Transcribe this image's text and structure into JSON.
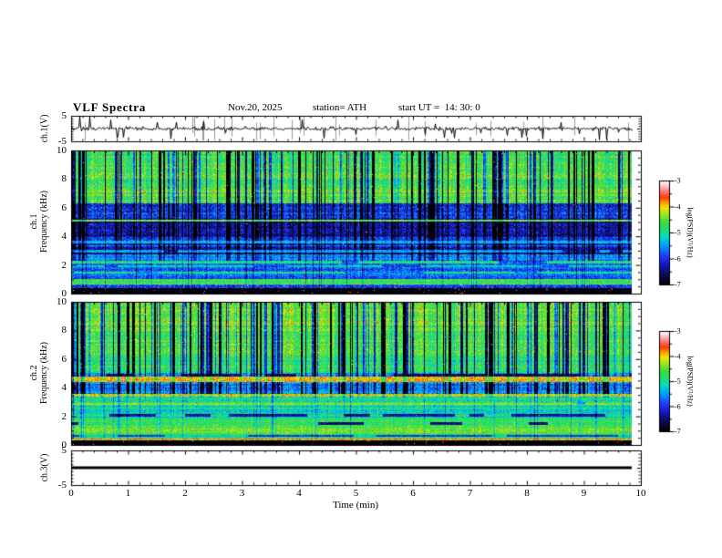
{
  "header": {
    "title": "VLF Spectra",
    "date": "Nov.20, 2025",
    "station": "station= ATH",
    "start_ut": "start UT =  14: 30: 0"
  },
  "xaxis": {
    "label": "Time (min)",
    "ticks": [
      "0",
      "1",
      "2",
      "3",
      "4",
      "5",
      "6",
      "7",
      "8",
      "9",
      "10"
    ],
    "range": [
      0,
      10
    ]
  },
  "panels": {
    "ch1wave": {
      "ylabel": "ch.1(V)",
      "ytop": "5",
      "ybottom": "-5",
      "yrange": [
        -5,
        5
      ]
    },
    "spec1": {
      "ylabel_line1": "ch.1",
      "ylabel_line2": "Frequency (kHz)",
      "yticks": [
        "10",
        "8",
        "6",
        "4",
        "2",
        "0"
      ],
      "yrange": [
        0,
        10
      ]
    },
    "spec2": {
      "ylabel_line1": "ch.2",
      "ylabel_line2": "Frequency (kHz)",
      "yticks": [
        "10",
        "8",
        "6",
        "4",
        "2",
        "0"
      ],
      "yrange": [
        0,
        10
      ]
    },
    "ch3": {
      "ylabel": "ch.3(V)",
      "ytop": "5",
      "ybottom": "-5",
      "yrange": [
        -5,
        5
      ]
    }
  },
  "colorbar": {
    "label": "log(PSD)(V²/Hz)",
    "ticks": [
      "-3",
      "-4",
      "-5",
      "-6",
      "-7"
    ],
    "zrange": [
      -7,
      -3
    ]
  },
  "chart_data": {
    "type": "heatmap",
    "title": "VLF Spectra",
    "time_axis": {
      "label": "Time (min)",
      "range": [
        0,
        10
      ],
      "data_end_min": 9.83
    },
    "colormap_stops": [
      [
        0.0,
        0,
        0,
        0
      ],
      [
        0.08,
        10,
        10,
        60
      ],
      [
        0.18,
        20,
        20,
        180
      ],
      [
        0.28,
        30,
        60,
        255
      ],
      [
        0.38,
        0,
        160,
        255
      ],
      [
        0.46,
        0,
        220,
        200
      ],
      [
        0.52,
        30,
        220,
        120
      ],
      [
        0.6,
        60,
        220,
        60
      ],
      [
        0.68,
        160,
        230,
        40
      ],
      [
        0.74,
        240,
        230,
        0
      ],
      [
        0.79,
        255,
        160,
        0
      ],
      [
        0.84,
        255,
        60,
        0
      ],
      [
        0.9,
        255,
        120,
        120
      ],
      [
        0.95,
        255,
        200,
        200
      ],
      [
        1.0,
        255,
        255,
        255
      ]
    ],
    "panels": [
      {
        "id": "ch1_waveform",
        "type": "line",
        "ylabel": "ch.1(V)",
        "yrange": [
          -5,
          5
        ],
        "mean_v": 0,
        "noise_sd_v": 0.7,
        "spike_rate": 0.055,
        "spike_max_v": 4.8,
        "gray_impulses": 26,
        "description": "noisy voltage trace centered on 0 V with impulsive sferic spikes"
      },
      {
        "id": "ch1_spectrogram",
        "type": "heatmap",
        "ylabel": "ch.1 Frequency (kHz)",
        "yrange": [
          0,
          10
        ],
        "zlabel": "log(PSD)(V²/Hz)",
        "zrange": [
          -7,
          -3
        ],
        "bands": [
          [
            0,
            0.38,
            -6.95,
            0.12,
            0,
            0.012
          ],
          [
            0.38,
            0.62,
            -6.1,
            0.5,
            0.15,
            0.03
          ],
          [
            0.62,
            1.0,
            -4.7,
            0.3,
            0.1,
            0.004
          ],
          [
            1.0,
            2.3,
            -5.85,
            0.45,
            0.35,
            0.004
          ],
          [
            2.3,
            2.75,
            -5.4,
            0.4,
            0.35,
            0.002
          ],
          [
            2.75,
            3.3,
            -6.3,
            0.45,
            0.6,
            0.002
          ],
          [
            3.3,
            3.95,
            -5.95,
            0.45,
            0.6,
            0.002
          ],
          [
            3.95,
            5.3,
            -6.35,
            0.45,
            0.7,
            0.002
          ],
          [
            5.3,
            6.3,
            -6.05,
            0.5,
            0.85,
            0.003
          ],
          [
            6.3,
            10,
            -4.62,
            0.45,
            1,
            0.01
          ]
        ],
        "lines": [
          [
            5.08,
            0.08,
            -4.45,
            0.5,
            1
          ],
          [
            3.62,
            0.1,
            -5.5,
            0.35,
            1
          ],
          [
            2.95,
            0.08,
            -5.45,
            0.3,
            0.9
          ],
          [
            2.2,
            0.07,
            -4.9,
            0.35,
            0.9
          ],
          [
            1.9,
            0.06,
            -5.15,
            0.3,
            0.8
          ],
          [
            1.45,
            0.06,
            -5.2,
            0.3,
            0.7
          ]
        ],
        "streaks": {
          "count": 95,
          "fmin": 2.3,
          "fmax": 10
        },
        "sferics": {
          "count": 42
        }
      },
      {
        "id": "ch2_spectrogram",
        "type": "heatmap",
        "ylabel": "ch.2 Frequency (kHz)",
        "yrange": [
          0,
          10
        ],
        "zlabel": "log(PSD)(V²/Hz)",
        "zrange": [
          -7,
          -3
        ],
        "bands": [
          [
            0,
            0.3,
            -6.95,
            0.1,
            0,
            0.012
          ],
          [
            0.3,
            0.44,
            -3.9,
            0.35,
            0,
            0.05
          ],
          [
            0.44,
            0.85,
            -4.95,
            0.35,
            0.12,
            0.006
          ],
          [
            0.85,
            1.12,
            -4.35,
            0.3,
            0.12,
            0.02
          ],
          [
            1.12,
            1.88,
            -4.65,
            0.35,
            0.18,
            0.006
          ],
          [
            1.88,
            2.38,
            -5.0,
            0.4,
            0.25,
            0.004
          ],
          [
            2.38,
            3.35,
            -5.05,
            0.4,
            0.3,
            0.005
          ],
          [
            3.35,
            3.58,
            -4.0,
            0.45,
            0.25,
            0.05
          ],
          [
            3.58,
            4.42,
            -5.6,
            0.45,
            0.7,
            0.003
          ],
          [
            4.42,
            4.78,
            -3.95,
            0.4,
            0.3,
            0.04
          ],
          [
            4.78,
            5.05,
            -5.5,
            0.5,
            0.6,
            0.004
          ],
          [
            5.05,
            6.15,
            -4.9,
            0.4,
            0.85,
            0.006
          ],
          [
            6.15,
            10,
            -4.6,
            0.4,
            1,
            0.012
          ]
        ],
        "lines": [
          [
            4.88,
            0.08,
            -6.5,
            0.5,
            0.75
          ],
          [
            2.9,
            0.07,
            -4.3,
            0.3,
            0.85
          ],
          [
            2.08,
            0.1,
            -6.45,
            0.4,
            0.5
          ],
          [
            1.52,
            0.1,
            -6.35,
            0.4,
            0.4
          ],
          [
            1.0,
            0.06,
            -4.2,
            0.3,
            0.7
          ],
          [
            0.62,
            0.05,
            -5.8,
            0.4,
            0.5
          ]
        ],
        "streaks": {
          "count": 115,
          "fmin": 3.3,
          "fmax": 10
        },
        "sferics": {
          "count": 48
        }
      },
      {
        "id": "ch3_waveform",
        "type": "line",
        "ylabel": "ch.3(V)",
        "yrange": [
          -5,
          5
        ],
        "value": 0,
        "description": "flat thick line at 0 V for full duration"
      }
    ]
  }
}
